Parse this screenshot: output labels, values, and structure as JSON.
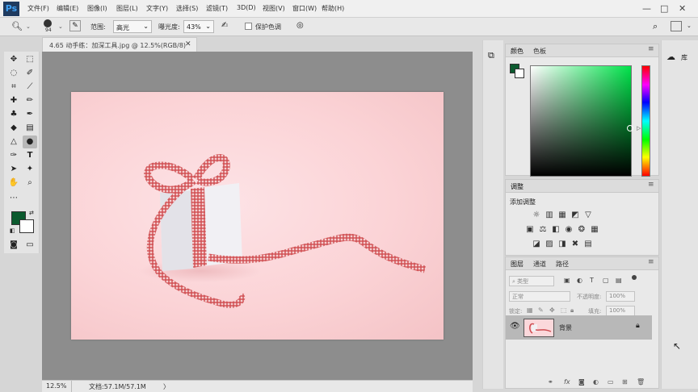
{
  "app": {
    "logo": "Ps"
  },
  "menubar": {
    "items": [
      "文件(F)",
      "编辑(E)",
      "图像(I)",
      "图层(L)",
      "文字(Y)",
      "选择(S)",
      "滤镜(T)",
      "3D(D)",
      "视图(V)",
      "窗口(W)",
      "帮助(H)"
    ],
    "window_controls": [
      "—",
      "□",
      "✕"
    ]
  },
  "options": {
    "brush_size": "94",
    "range_label": "范围:",
    "range_value": "高光",
    "exposure_label": "曝光度:",
    "exposure_value": "43%",
    "protect_tones_label": "保护色调"
  },
  "document": {
    "tab_title": "4.65 动手练：加深工具.jpg @ 12.5%(RGB/8)",
    "tab_close": "✕"
  },
  "status": {
    "zoom": "12.5%",
    "doc_info": "文档:57.1M/57.1M",
    "arrow": "〉"
  },
  "colors": {
    "foreground": "#0b5a2e",
    "background": "#ffffff",
    "accent_field": "#00e34a"
  },
  "color_panel": {
    "tabs": [
      "颜色",
      "色板"
    ]
  },
  "adjustments_panel": {
    "tabs": [
      "调整"
    ],
    "add_label": "添加调整"
  },
  "layers_panel": {
    "tabs": [
      "图层",
      "通道",
      "路径"
    ],
    "filter_placeholder": "类型",
    "blend_mode": "正常",
    "opacity_label": "不透明度:",
    "opacity_value": "100%",
    "lock_label": "锁定:",
    "fill_label": "填充:",
    "fill_value": "100%",
    "layers": [
      {
        "name": "背景"
      }
    ]
  },
  "libraries": {
    "label": "库"
  }
}
